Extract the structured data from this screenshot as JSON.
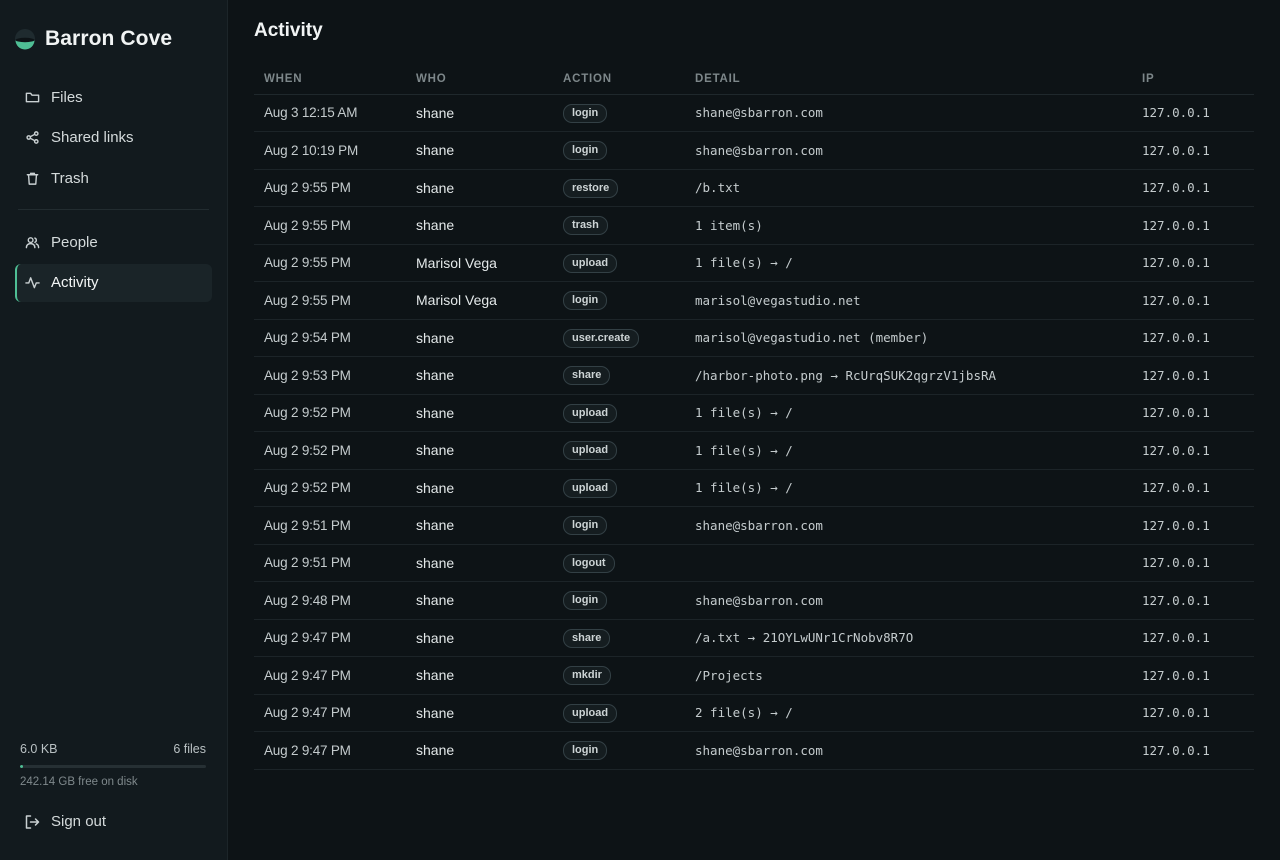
{
  "brand": {
    "name": "Barron Cove"
  },
  "nav": {
    "primary": [
      {
        "label": "Files",
        "icon": "folder-icon"
      },
      {
        "label": "Shared links",
        "icon": "share-icon"
      },
      {
        "label": "Trash",
        "icon": "trash-icon"
      }
    ],
    "secondary": [
      {
        "label": "People",
        "icon": "people-icon"
      },
      {
        "label": "Activity",
        "icon": "activity-icon",
        "active": true
      }
    ]
  },
  "storage": {
    "used": "6.0 KB",
    "files": "6 files",
    "free": "242.14 GB free on disk",
    "used_fraction": 0.01
  },
  "signout": {
    "label": "Sign out"
  },
  "page": {
    "title": "Activity"
  },
  "table": {
    "headers": {
      "when": "WHEN",
      "who": "WHO",
      "action": "ACTION",
      "detail": "DETAIL",
      "ip": "IP"
    },
    "rows": [
      {
        "when": "Aug 3 12:15 AM",
        "who": "shane",
        "action": "login",
        "detail": "shane@sbarron.com",
        "ip": "127.0.0.1"
      },
      {
        "when": "Aug 2 10:19 PM",
        "who": "shane",
        "action": "login",
        "detail": "shane@sbarron.com",
        "ip": "127.0.0.1"
      },
      {
        "when": "Aug 2 9:55 PM",
        "who": "shane",
        "action": "restore",
        "detail": "/b.txt",
        "ip": "127.0.0.1"
      },
      {
        "when": "Aug 2 9:55 PM",
        "who": "shane",
        "action": "trash",
        "detail": "1 item(s)",
        "ip": "127.0.0.1"
      },
      {
        "when": "Aug 2 9:55 PM",
        "who": "Marisol Vega",
        "action": "upload",
        "detail": "1 file(s) → /",
        "ip": "127.0.0.1"
      },
      {
        "when": "Aug 2 9:55 PM",
        "who": "Marisol Vega",
        "action": "login",
        "detail": "marisol@vegastudio.net",
        "ip": "127.0.0.1"
      },
      {
        "when": "Aug 2 9:54 PM",
        "who": "shane",
        "action": "user.create",
        "detail": "marisol@vegastudio.net (member)",
        "ip": "127.0.0.1"
      },
      {
        "when": "Aug 2 9:53 PM",
        "who": "shane",
        "action": "share",
        "detail": "/harbor-photo.png → RcUrqSUK2qgrzV1jbsRA",
        "ip": "127.0.0.1"
      },
      {
        "when": "Aug 2 9:52 PM",
        "who": "shane",
        "action": "upload",
        "detail": "1 file(s) → /",
        "ip": "127.0.0.1"
      },
      {
        "when": "Aug 2 9:52 PM",
        "who": "shane",
        "action": "upload",
        "detail": "1 file(s) → /",
        "ip": "127.0.0.1"
      },
      {
        "when": "Aug 2 9:52 PM",
        "who": "shane",
        "action": "upload",
        "detail": "1 file(s) → /",
        "ip": "127.0.0.1"
      },
      {
        "when": "Aug 2 9:51 PM",
        "who": "shane",
        "action": "login",
        "detail": "shane@sbarron.com",
        "ip": "127.0.0.1"
      },
      {
        "when": "Aug 2 9:51 PM",
        "who": "shane",
        "action": "logout",
        "detail": "",
        "ip": "127.0.0.1"
      },
      {
        "when": "Aug 2 9:48 PM",
        "who": "shane",
        "action": "login",
        "detail": "shane@sbarron.com",
        "ip": "127.0.0.1"
      },
      {
        "when": "Aug 2 9:47 PM",
        "who": "shane",
        "action": "share",
        "detail": "/a.txt → 21OYLwUNr1CrNobv8R7O",
        "ip": "127.0.0.1"
      },
      {
        "when": "Aug 2 9:47 PM",
        "who": "shane",
        "action": "mkdir",
        "detail": "/Projects",
        "ip": "127.0.0.1"
      },
      {
        "when": "Aug 2 9:47 PM",
        "who": "shane",
        "action": "upload",
        "detail": "2 file(s) → /",
        "ip": "127.0.0.1"
      },
      {
        "when": "Aug 2 9:47 PM",
        "who": "shane",
        "action": "login",
        "detail": "shane@sbarron.com",
        "ip": "127.0.0.1"
      }
    ]
  },
  "colors": {
    "accent": "#4fbf95",
    "background": "#0d1316",
    "sidebar": "#121a1e"
  }
}
